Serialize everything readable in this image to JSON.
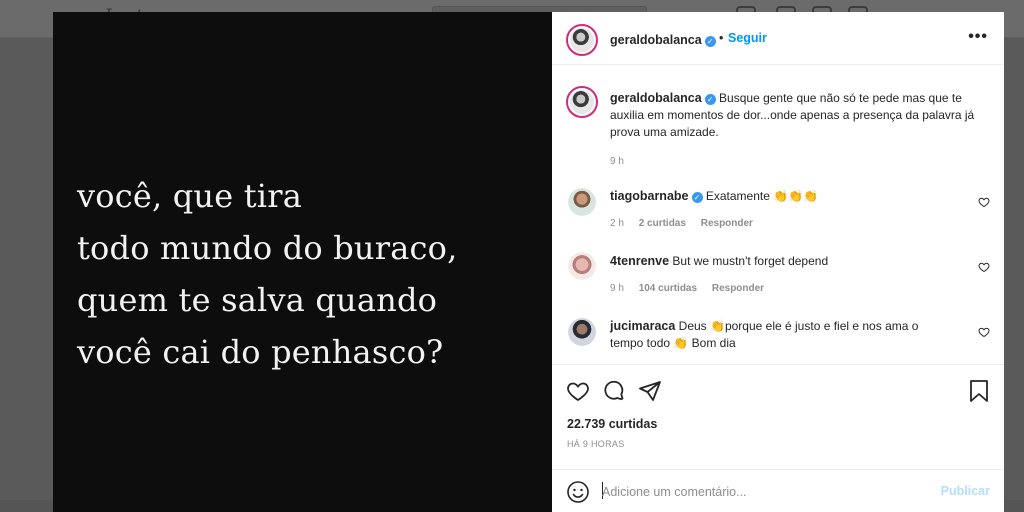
{
  "background": {
    "logo_text": "Instagram"
  },
  "post": {
    "quote_lines": [
      "você, que tira",
      "todo mundo do buraco,",
      "quem te salva quando",
      "você cai do penhasco?"
    ]
  },
  "header": {
    "username": "geraldobalanca",
    "separator": "•",
    "follow_label": "Seguir",
    "more_label": "•••"
  },
  "caption": {
    "username": "geraldobalanca",
    "text": "Busque gente que não só te pede mas que te auxilia em momentos de dor...onde apenas a presença da palavra já prova uma amizade.",
    "time": "9 h"
  },
  "comments": [
    {
      "username": "tiagobarnabe",
      "verified": true,
      "text": "Exatamente 👏👏👏",
      "time": "2 h",
      "likes": "2 curtidas",
      "reply": "Responder"
    },
    {
      "username": "4tenrenve",
      "verified": false,
      "text": "But we mustn't forget depend",
      "time": "9 h",
      "likes": "104 curtidas",
      "reply": "Responder"
    },
    {
      "username": "jucimaraca",
      "verified": false,
      "text": "Deus 👏porque ele é justo e fiel e nos ama o tempo todo 👏 Bom dia"
    }
  ],
  "stats": {
    "likes": "22.739 curtidas",
    "time_ago": "HÁ 9 HORAS"
  },
  "add_comment": {
    "placeholder": "Adicione um comentário...",
    "publish_label": "Publicar"
  },
  "colors": {
    "accent_blue": "#0095f6",
    "publish_disabled": "#b2dffc",
    "verified_blue": "#3897f0",
    "text": "#262626",
    "muted": "#8e8e8e"
  }
}
